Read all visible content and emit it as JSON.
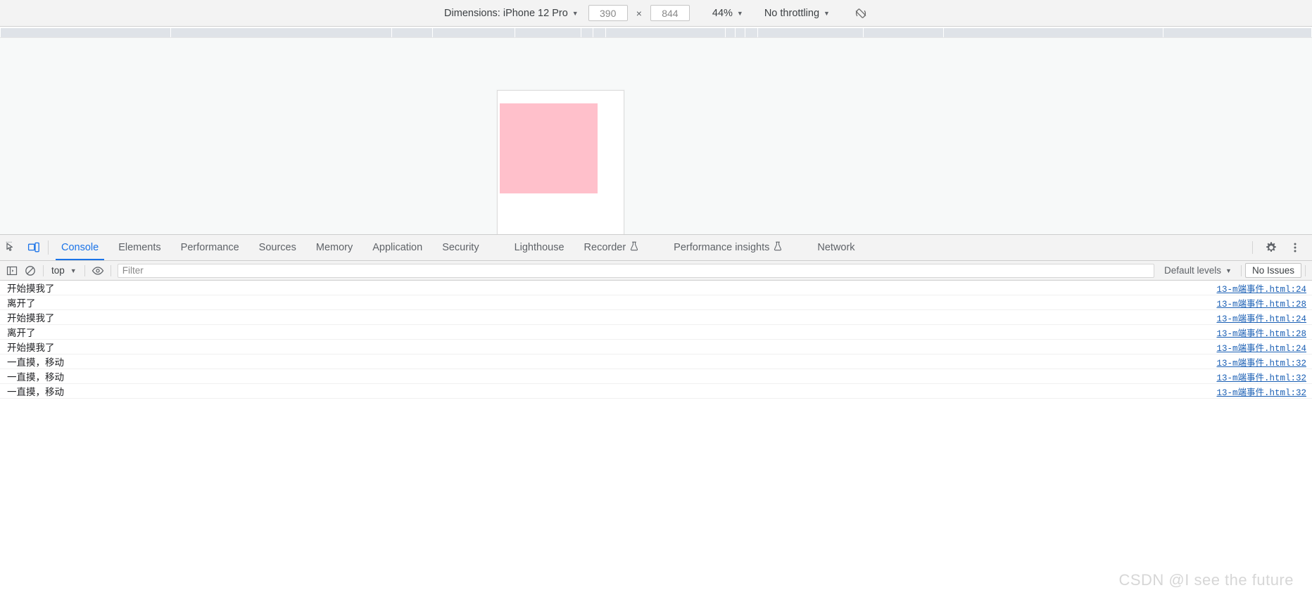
{
  "device_toolbar": {
    "dimensions_label": "Dimensions: iPhone 12 Pro",
    "width_value": "390",
    "height_value": "844",
    "times_symbol": "×",
    "zoom_label": "44%",
    "throttling_label": "No throttling",
    "rotate_icon": "rotate-device-icon"
  },
  "devtools_tabs": [
    {
      "label": "Console",
      "selected": true,
      "experimental": false
    },
    {
      "label": "Elements",
      "selected": false,
      "experimental": false
    },
    {
      "label": "Performance",
      "selected": false,
      "experimental": false
    },
    {
      "label": "Sources",
      "selected": false,
      "experimental": false
    },
    {
      "label": "Memory",
      "selected": false,
      "experimental": false
    },
    {
      "label": "Application",
      "selected": false,
      "experimental": false
    },
    {
      "label": "Security",
      "selected": false,
      "experimental": false
    },
    {
      "label": "Lighthouse",
      "selected": false,
      "experimental": false
    },
    {
      "label": "Recorder",
      "selected": false,
      "experimental": true
    },
    {
      "label": "Performance insights",
      "selected": false,
      "experimental": true
    },
    {
      "label": "Network",
      "selected": false,
      "experimental": false
    }
  ],
  "tabbar_right": {
    "settings_icon": "gear-icon",
    "more_icon": "more-vertical-icon"
  },
  "console_toolbar": {
    "sidebar_icon": "console-sidebar-icon",
    "clear_icon": "clear-console-icon",
    "context_label": "top",
    "eye_icon": "live-expression-eye-icon",
    "filter_placeholder": "Filter",
    "filter_value": "",
    "levels_label": "Default levels",
    "issues_label": "No Issues"
  },
  "console_messages": [
    {
      "text": "开始摸我了",
      "source": "13-m端事件.html:24"
    },
    {
      "text": "离开了",
      "source": "13-m端事件.html:28"
    },
    {
      "text": "开始摸我了",
      "source": "13-m端事件.html:24"
    },
    {
      "text": "离开了",
      "source": "13-m端事件.html:28"
    },
    {
      "text": "开始摸我了",
      "source": "13-m端事件.html:24"
    },
    {
      "text": "一直摸，移动",
      "source": "13-m端事件.html:32"
    },
    {
      "text": "一直摸，移动",
      "source": "13-m端事件.html:32"
    },
    {
      "text": "一直摸，移动",
      "source": "13-m端事件.html:32"
    }
  ],
  "viewport": {
    "page_background": "#ffffff",
    "box_color": "#ffc0cb"
  },
  "watermark": {
    "text": "CSDN @I see the future"
  },
  "colors": {
    "accent": "#1a73e8",
    "toolbar_bg": "#f3f3f3",
    "stage_bg": "#f7f9f9",
    "ruler_bg": "#dfe3e8",
    "link": "#1a5fb4"
  }
}
